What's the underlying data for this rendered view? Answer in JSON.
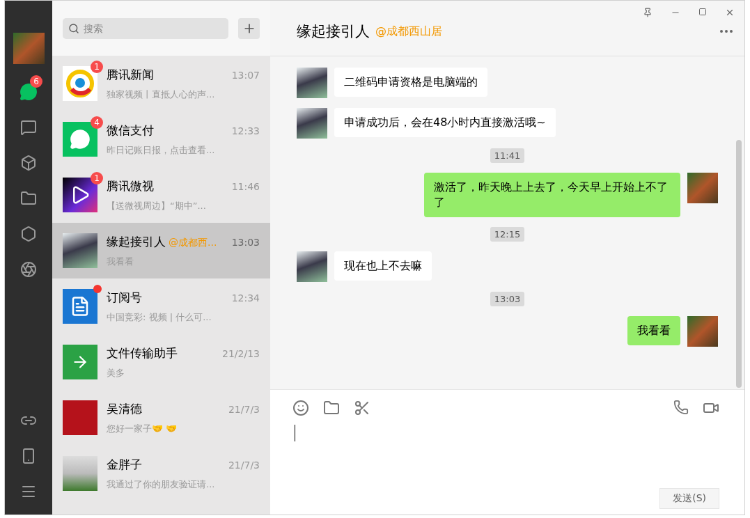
{
  "nav": {
    "unread_badge": "6",
    "items": [
      {
        "kind": "chats",
        "selected": true
      },
      {
        "kind": "contacts",
        "selected": false
      },
      {
        "kind": "favorites",
        "selected": false
      },
      {
        "kind": "files",
        "selected": false
      },
      {
        "kind": "moments",
        "selected": false
      },
      {
        "kind": "channels",
        "selected": false
      }
    ],
    "bottom": [
      {
        "kind": "mini-programs"
      },
      {
        "kind": "phone"
      },
      {
        "kind": "menu"
      }
    ]
  },
  "search": {
    "placeholder": "搜索"
  },
  "chats": [
    {
      "kind": "news",
      "name": "腾讯新闻",
      "preview": "独家视频丨直抵人心的声...",
      "time": "13:07",
      "badge": "1",
      "dot": false,
      "selected": false
    },
    {
      "kind": "pay",
      "name": "微信支付",
      "preview": "昨日记账日报，点击查看...",
      "time": "12:33",
      "badge": "4",
      "dot": false,
      "selected": false
    },
    {
      "kind": "video",
      "name": "腾讯微视",
      "preview": "【送微视周边】“期中”...",
      "time": "11:46",
      "badge": "1",
      "dot": false,
      "selected": false
    },
    {
      "kind": "drawing",
      "name": "缘起接引人",
      "group": "@成都西...",
      "preview": "我看看",
      "time": "13:03",
      "dot": false,
      "selected": true
    },
    {
      "kind": "subscription",
      "name": "订阅号",
      "preview": "中国竞彩: 视频 | 什么可...",
      "time": "12:34",
      "dot": true,
      "selected": false
    },
    {
      "kind": "file",
      "name": "文件传输助手",
      "preview": "美多",
      "time": "21/2/13",
      "dot": false,
      "selected": false
    },
    {
      "kind": "red-photo",
      "name": "吴清德",
      "preview": "您好一家子🤝 🤝",
      "time": "21/7/3",
      "dot": false,
      "selected": false
    },
    {
      "kind": "photo",
      "name": "金胖子",
      "preview": "我通过了你的朋友验证请...",
      "time": "21/7/3",
      "dot": false,
      "selected": false
    }
  ],
  "conversation": {
    "title": "缘起接引人",
    "group": "@成都西山居",
    "messages": [
      {
        "kind": "incoming",
        "text": "二维码申请资格是电脑端的"
      },
      {
        "kind": "incoming",
        "text": "申请成功后，会在48小时内直接激活哦~"
      },
      {
        "kind": "time",
        "text": "11:41"
      },
      {
        "kind": "outgoing",
        "text": "激活了，昨天晚上上去了，今天早上开始上不了了"
      },
      {
        "kind": "time",
        "text": "12:15"
      },
      {
        "kind": "incoming",
        "text": "现在也上不去嘛"
      },
      {
        "kind": "time",
        "text": "13:03"
      },
      {
        "kind": "outgoing",
        "text": "我看看"
      }
    ]
  },
  "send_button": "发送(S)"
}
